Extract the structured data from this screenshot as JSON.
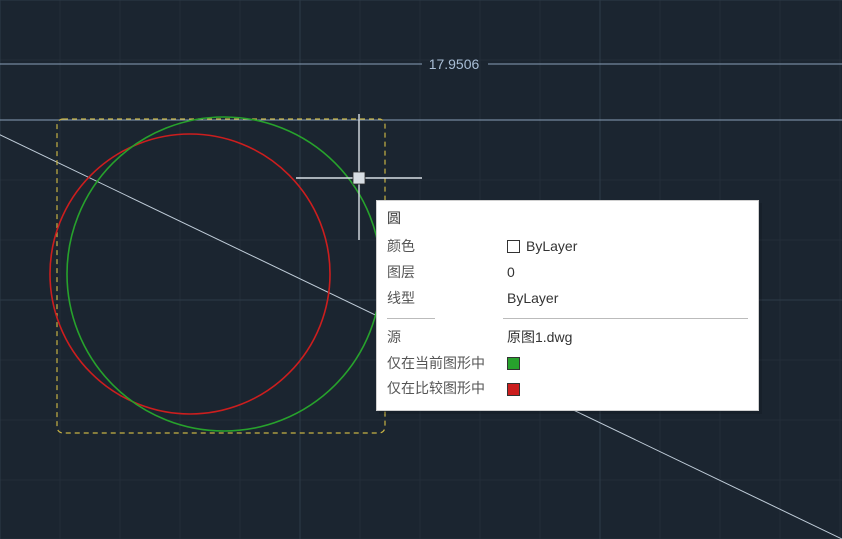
{
  "dimension_value": "17.9506",
  "tooltip": {
    "title": "圆",
    "rows": {
      "color_label": "颜色",
      "color_value": "ByLayer",
      "layer_label": "图层",
      "layer_value": "0",
      "linetype_label": "线型",
      "linetype_value": "ByLayer",
      "source_label": "源",
      "source_value": "原图1.dwg",
      "current_label": "仅在当前图形中",
      "compare_label": "仅在比较图形中"
    }
  },
  "colors": {
    "swatch_bylayer": "#ffffff",
    "swatch_current": "#27a22c",
    "swatch_compare": "#cc1e1e"
  }
}
